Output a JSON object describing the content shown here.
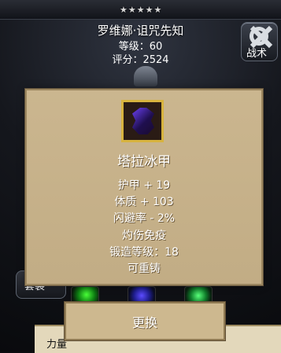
{
  "header": {
    "stars": "★★★★★",
    "hero_name": "罗维娜·诅咒先知",
    "level_text": "等级：60",
    "score_text": "评分：2524"
  },
  "buttons": {
    "tactics_label": "战术",
    "replace_label": "更换",
    "left_label": "套装"
  },
  "bottom_panel": {
    "label": "力量"
  },
  "item": {
    "name": "塔拉冰甲",
    "attributes": [
      "护甲 + 19",
      "体质 + 103",
      "闪避率 - 2%",
      "灼伤免疫",
      "锻造等级：18",
      "可重铸"
    ]
  },
  "colors": {
    "tooltip_bg": "#c8b289",
    "item_frame": "#d7b33f",
    "armor_icon": "#6c41f5"
  }
}
